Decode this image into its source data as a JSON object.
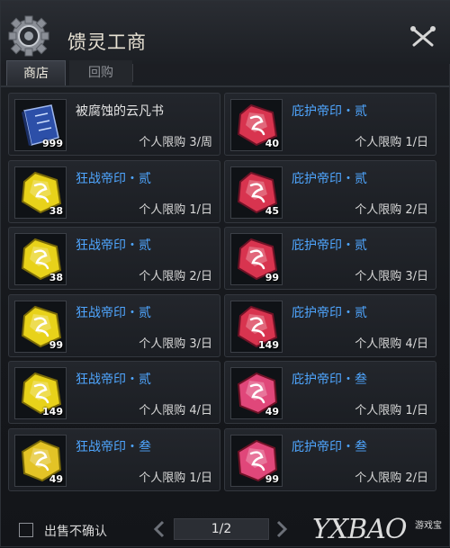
{
  "header": {
    "title": "馈灵工商"
  },
  "tabs": [
    {
      "label": "商店"
    },
    {
      "label": "回购"
    }
  ],
  "items": [
    {
      "name": "被腐蚀的云凡书",
      "limit": "个人限购 3/周",
      "qty": "999",
      "kind": "book"
    },
    {
      "name": "庇护帝印・贰",
      "limit": "个人限购 1/日",
      "qty": "40",
      "kind": "red"
    },
    {
      "name": "狂战帝印・贰",
      "limit": "个人限购 1/日",
      "qty": "38",
      "kind": "yellow"
    },
    {
      "name": "庇护帝印・贰",
      "limit": "个人限购 2/日",
      "qty": "45",
      "kind": "red"
    },
    {
      "name": "狂战帝印・贰",
      "limit": "个人限购 2/日",
      "qty": "38",
      "kind": "yellow"
    },
    {
      "name": "庇护帝印・贰",
      "limit": "个人限购 3/日",
      "qty": "99",
      "kind": "red"
    },
    {
      "name": "狂战帝印・贰",
      "limit": "个人限购 3/日",
      "qty": "99",
      "kind": "yellow"
    },
    {
      "name": "庇护帝印・贰",
      "limit": "个人限购 4/日",
      "qty": "149",
      "kind": "red"
    },
    {
      "name": "狂战帝印・贰",
      "limit": "个人限购 4/日",
      "qty": "149",
      "kind": "yellow"
    },
    {
      "name": "庇护帝印・叁",
      "limit": "个人限购 1/日",
      "qty": "49",
      "kind": "pink"
    },
    {
      "name": "狂战帝印・叁",
      "limit": "个人限购 1/日",
      "qty": "49",
      "kind": "gold"
    },
    {
      "name": "庇护帝印・叁",
      "limit": "个人限购 2/日",
      "qty": "99",
      "kind": "pink"
    }
  ],
  "footer": {
    "checkbox_label": "出售不确认",
    "page": "1/2",
    "watermark": "YXBAO",
    "watermark_sub": "游戏宝"
  },
  "colors": {
    "name_blue": "#4fa6ff",
    "name_white": "#e4e4e4",
    "gem_red": "#d8344f",
    "gem_yellow": "#e8d21a",
    "gem_pink": "#e0477a",
    "gem_gold": "#e3c326",
    "book_blue": "#2c4fa8"
  },
  "icons": {
    "header": "gear-icon",
    "close": "crossed-tools-icon",
    "prev": "chevron-left-icon",
    "next": "chevron-right-icon"
  }
}
